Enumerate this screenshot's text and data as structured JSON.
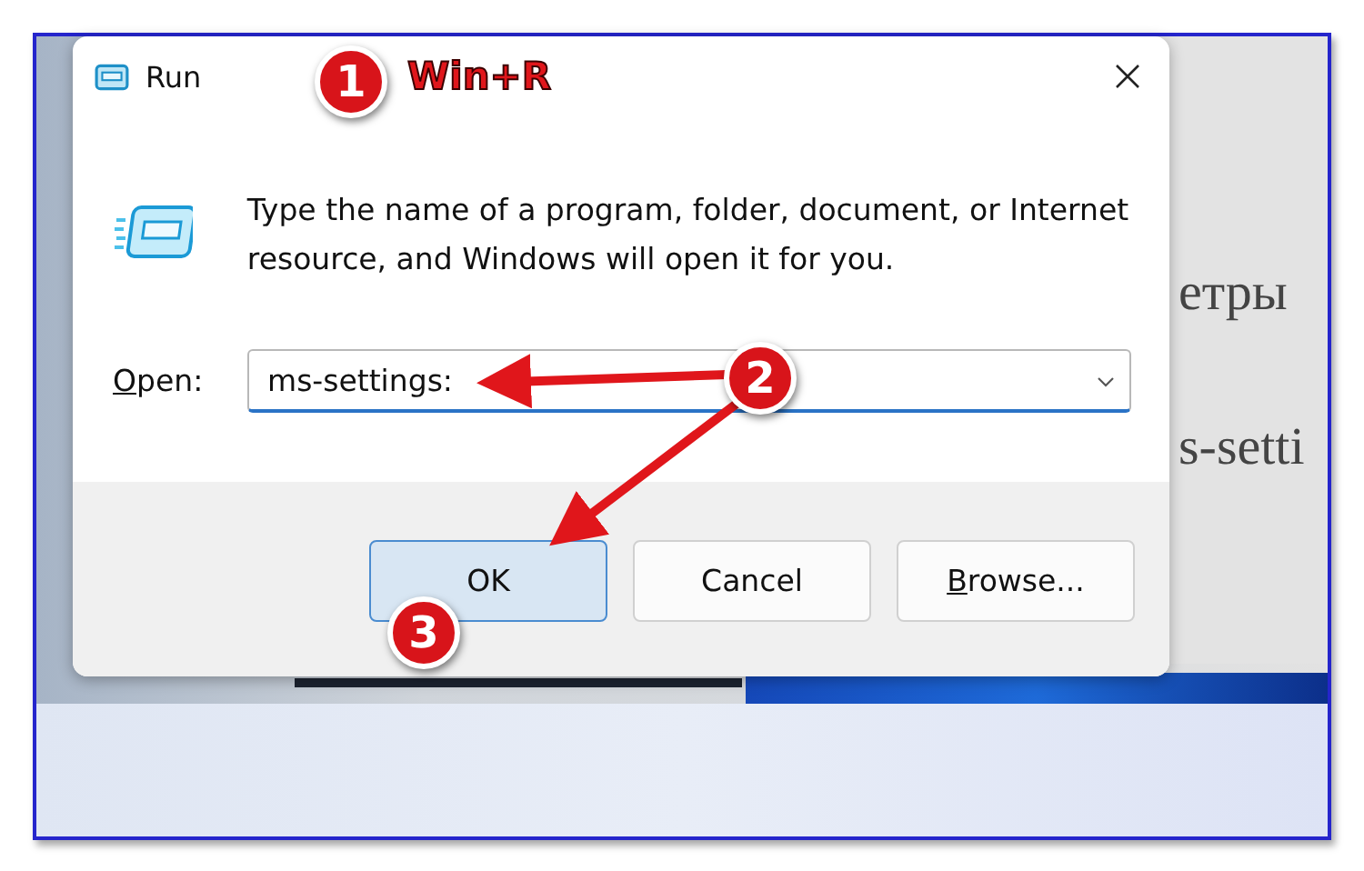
{
  "window": {
    "title": "Run"
  },
  "message": "Type the name of a program, folder, document, or Internet resource, and Windows will open it for you.",
  "open": {
    "label": "Open:",
    "label_access_key": true,
    "value": "ms-settings:"
  },
  "buttons": [
    {
      "label": "OK",
      "default": true,
      "access_key": false
    },
    {
      "label": "Cancel",
      "default": false,
      "access_key": false
    },
    {
      "label": "Browse...",
      "default": false,
      "access_key": true
    }
  ],
  "background_texts": [
    "етры",
    "s-setti"
  ],
  "annotations": {
    "hotkey": "Win+R",
    "steps": [
      "1",
      "2",
      "3"
    ]
  }
}
